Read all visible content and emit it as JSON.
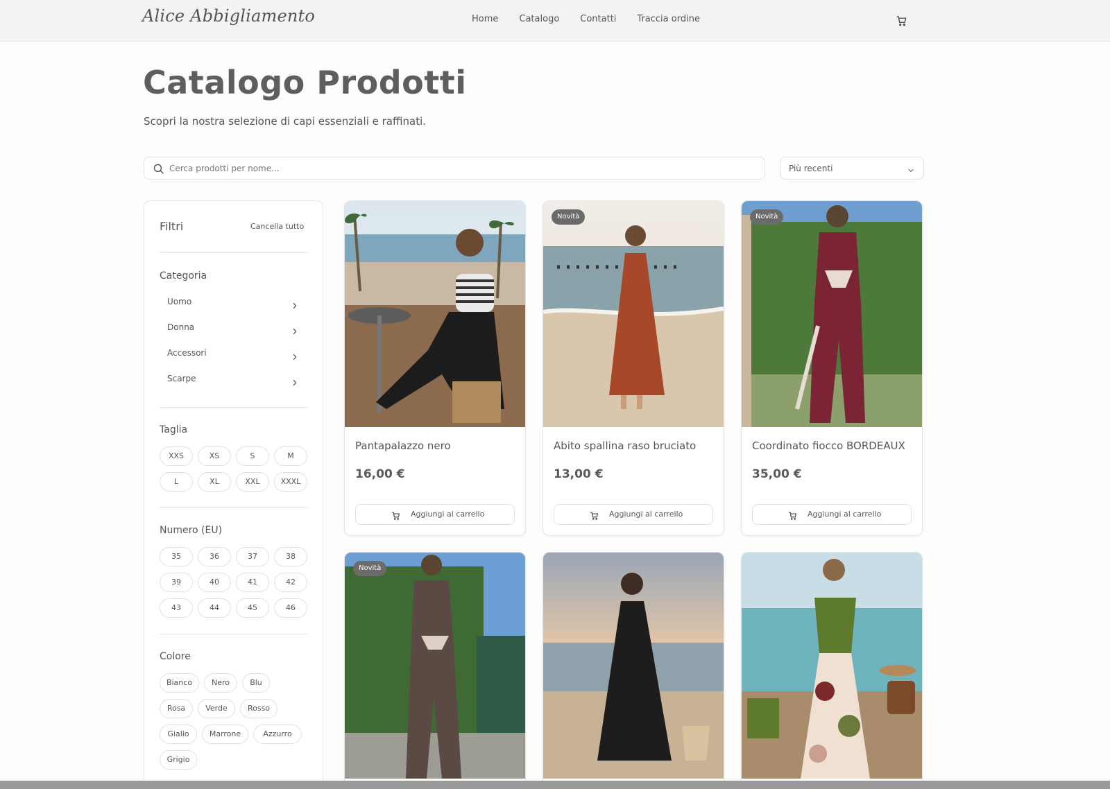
{
  "header": {
    "logo": "Alice Abbigliamento",
    "nav": [
      "Home",
      "Catalogo",
      "Contatti",
      "Traccia ordine"
    ],
    "cart_icon": "cart-icon"
  },
  "page": {
    "title": "Catalogo Prodotti",
    "subtitle": "Scopri la nostra selezione di capi essenziali e raffinati."
  },
  "search": {
    "placeholder": "Cerca prodotti per nome...",
    "value": ""
  },
  "sort": {
    "selected": "Più recenti"
  },
  "filters": {
    "title": "Filtri",
    "clear_all": "Cancella tutto",
    "category_title": "Categoria",
    "categories": [
      "Uomo",
      "Donna",
      "Accessori",
      "Scarpe"
    ],
    "size_title": "Taglia",
    "sizes": [
      "XXS",
      "XS",
      "S",
      "M",
      "L",
      "XL",
      "XXL",
      "XXXL"
    ],
    "shoe_title": "Numero (EU)",
    "shoe_sizes": [
      "35",
      "36",
      "37",
      "38",
      "39",
      "40",
      "41",
      "42",
      "43",
      "44",
      "45",
      "46"
    ],
    "color_title": "Colore",
    "colors": [
      "Bianco",
      "Nero",
      "Blu",
      "Rosa",
      "Verde",
      "Rosso",
      "Giallo",
      "Marrone",
      "Azzurro",
      "Grigio"
    ]
  },
  "products": [
    {
      "name": "Pantapalazzo nero",
      "price": "16,00 €",
      "badge": "",
      "add_label": "Aggiungi al carrello"
    },
    {
      "name": "Abito spallina raso bruciato",
      "price": "13,00 €",
      "badge": "Novità",
      "add_label": "Aggiungi al carrello"
    },
    {
      "name": "Coordinato fiocco BORDEAUX",
      "price": "35,00 €",
      "badge": "Novità",
      "add_label": "Aggiungi al carrello"
    },
    {
      "name": "",
      "price": "",
      "badge": "Novità",
      "add_label": ""
    },
    {
      "name": "",
      "price": "",
      "badge": "",
      "add_label": ""
    },
    {
      "name": "",
      "price": "",
      "badge": "",
      "add_label": ""
    }
  ],
  "colors": {
    "accent": "#6b6b6b",
    "text": "#555555",
    "border": "#e4e4e4"
  }
}
